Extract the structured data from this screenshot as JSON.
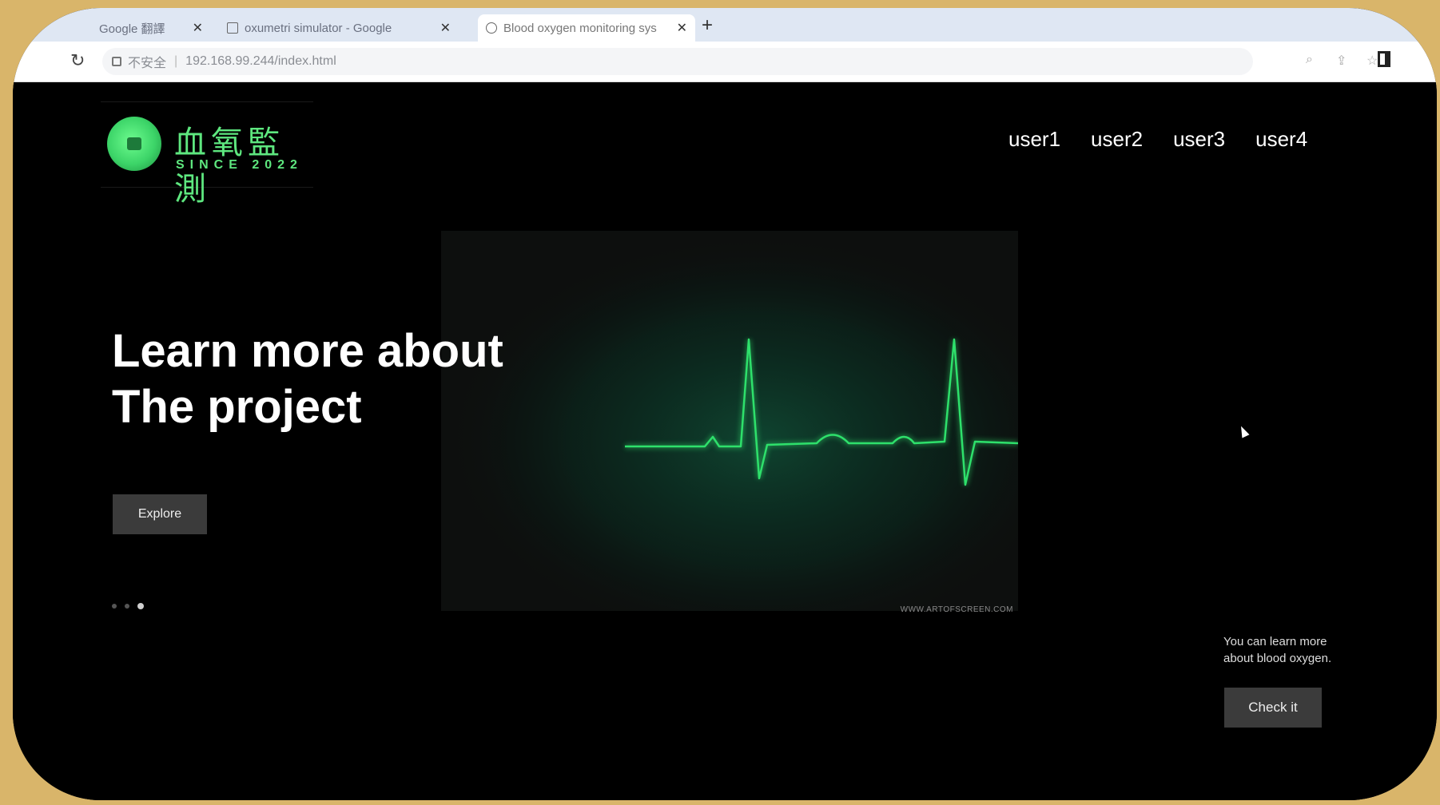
{
  "browser": {
    "tabs": [
      {
        "label": "Google 翻譯",
        "active": false
      },
      {
        "label": "oxumetri simulator - Google",
        "active": false
      },
      {
        "label": "Blood oxygen monitoring sys",
        "active": true
      }
    ],
    "new_tab": "+",
    "url": {
      "security_label": "不安全",
      "address": "192.168.99.244/index.html"
    }
  },
  "header": {
    "logo_title": "血氧監測",
    "logo_subtitle": "SINCE 2022",
    "nav": [
      {
        "label": "user1"
      },
      {
        "label": "user2"
      },
      {
        "label": "user3"
      },
      {
        "label": "user4"
      }
    ]
  },
  "hero": {
    "title_line1": "Learn more about",
    "title_line2": "The project",
    "explore_label": "Explore",
    "image_caption": "WWW.ARTOFSCREEN.COM",
    "slide_count": 3,
    "active_slide": 3
  },
  "side_panel": {
    "text": "You can learn more about blood oxygen.",
    "button_label": "Check it"
  },
  "colors": {
    "accent_green": "#5ee77f",
    "ecg_green": "#2ee06b",
    "page_background": "#000000",
    "button_background": "#3b3b3b"
  }
}
